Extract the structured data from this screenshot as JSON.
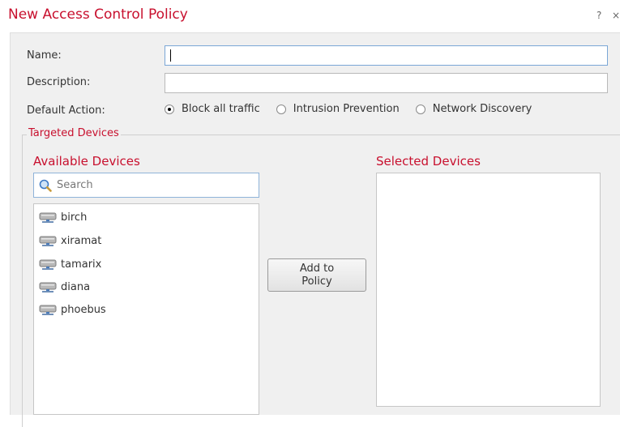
{
  "dialog": {
    "title": "New Access Control Policy",
    "help_label": "?",
    "close_label": "×"
  },
  "form": {
    "name_label": "Name:",
    "name_value": "",
    "description_label": "Description:",
    "description_value": "",
    "default_action_label": "Default Action:",
    "default_action_options": [
      {
        "label": "Block all traffic",
        "selected": true
      },
      {
        "label": "Intrusion Prevention",
        "selected": false
      },
      {
        "label": "Network Discovery",
        "selected": false
      }
    ]
  },
  "targeted_devices": {
    "legend": "Targeted Devices",
    "available_title": "Available Devices",
    "selected_title": "Selected Devices",
    "search_placeholder": "Search",
    "available": [
      "birch",
      "xiramat",
      "tamarix",
      "diana",
      "phoebus"
    ],
    "selected": [],
    "add_button_line1": "Add to",
    "add_button_line2": "Policy"
  },
  "colors": {
    "accent": "#c8102e",
    "panel_bg": "#f0f0f0"
  }
}
